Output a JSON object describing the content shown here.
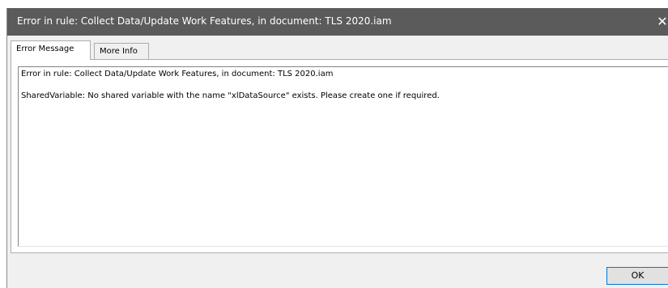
{
  "window": {
    "title": "Error in rule: Collect Data/Update Work Features, in document: TLS 2020.iam",
    "close_glyph": "✕"
  },
  "tabs": [
    {
      "label": "Error Message",
      "active": true
    },
    {
      "label": "More Info",
      "active": false
    }
  ],
  "message": {
    "line1": "Error in rule: Collect Data/Update Work Features, in document: TLS 2020.iam",
    "line2": "SharedVariable: No shared variable with the name \"xlDataSource\" exists.  Please create one if required."
  },
  "buttons": {
    "ok_label": "OK"
  },
  "colors": {
    "titlebar": "#5b5b5b",
    "dialog_bg": "#f0f0f0",
    "ok_border": "#0078d7"
  }
}
